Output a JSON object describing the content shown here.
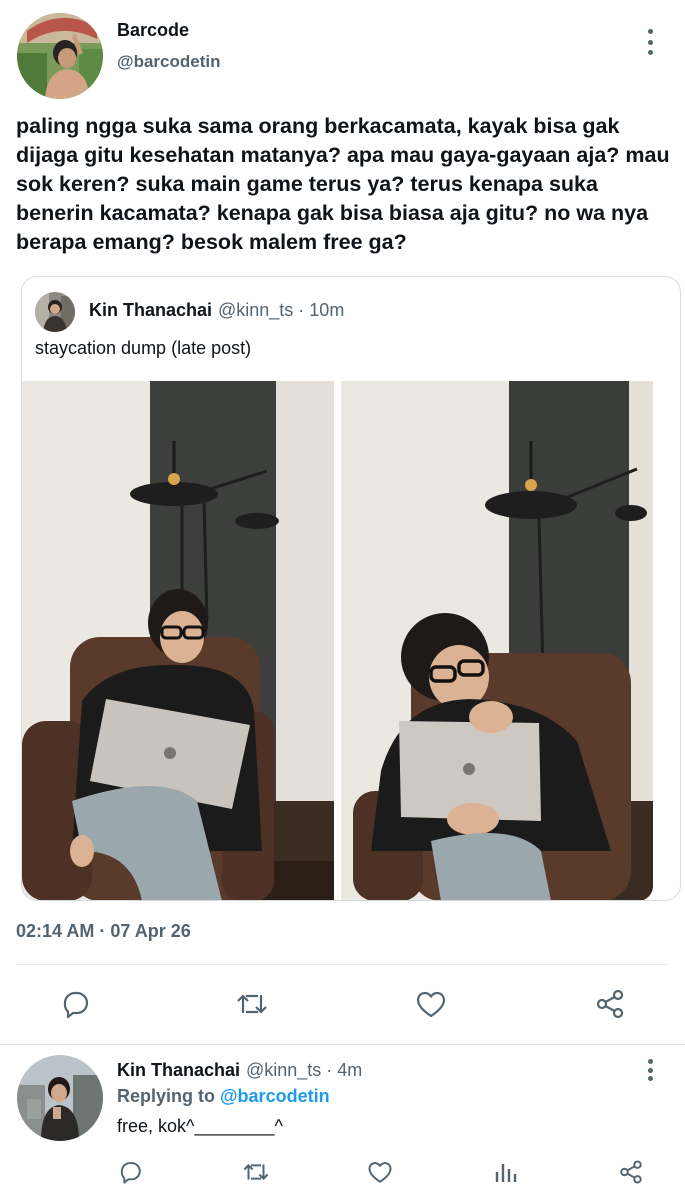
{
  "tweet": {
    "author": {
      "name": "Barcode",
      "handle": "@barcodetin",
      "avatar_icon": "user-avatar"
    },
    "text": "paling ngga suka sama orang berkacamata, kayak bisa gak dijaga gitu kesehatan matanya? apa mau gaya-gayaan aja? mau sok keren? suka main game terus ya? terus kenapa suka benerin kacamata? kenapa gak bisa biasa aja gitu? no wa nya berapa emang? besok malem free ga?",
    "timestamp": "02:14 AM · 07 Apr 26",
    "quoted": {
      "name": "Kin Thanachai",
      "meta": "@kinn_ts · 10m",
      "text": "staycation dump (late post)",
      "photos": [
        "photo-1",
        "photo-2"
      ]
    },
    "actions": [
      "reply-icon",
      "retweet-icon",
      "like-icon",
      "share-icon"
    ]
  },
  "reply": {
    "name": "Kin Thanachai",
    "meta": "@kinn_ts · 4m",
    "replying_label": "Replying to ",
    "replying_handle": "@barcodetin",
    "text": "free, kok^________^",
    "actions": [
      "reply-icon",
      "retweet-icon",
      "like-icon",
      "analytics-icon",
      "share-icon"
    ]
  },
  "colors": {
    "text": "#0f1419",
    "secondary": "#536471",
    "accent": "#1d9bf0",
    "border": "#d6dde2"
  }
}
